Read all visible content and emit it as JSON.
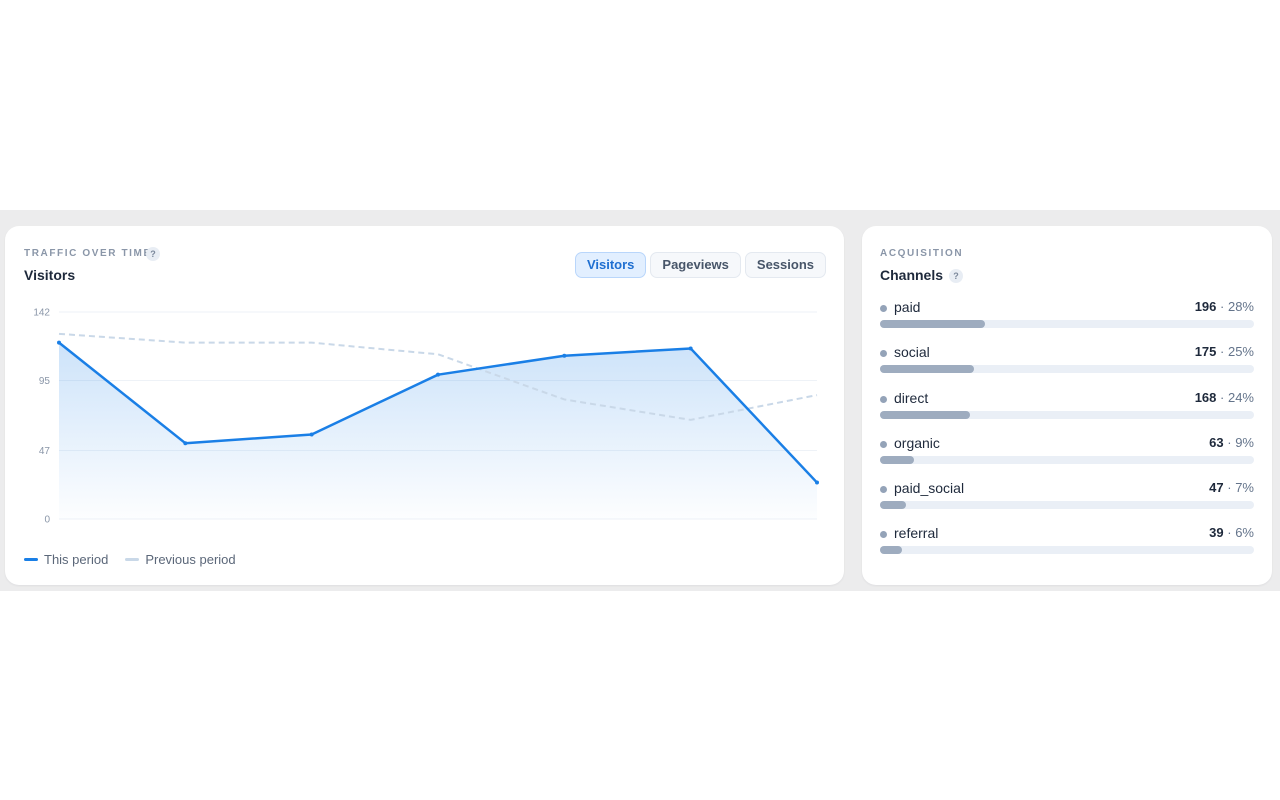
{
  "traffic": {
    "eyebrow": "TRAFFIC OVER TIME",
    "help": "?",
    "title": "Visitors",
    "tabs": [
      {
        "label": "Visitors",
        "active": true
      },
      {
        "label": "Pageviews",
        "active": false
      },
      {
        "label": "Sessions",
        "active": false
      }
    ],
    "legend": {
      "current": "This period",
      "previous": "Previous period"
    }
  },
  "chart_data": {
    "type": "area",
    "title": "Visitors",
    "ylim": [
      0,
      142
    ],
    "yticks": [
      0,
      47,
      95,
      142
    ],
    "grid": true,
    "legend_position": "bottom-left",
    "series": [
      {
        "name": "This period",
        "color": "#1a7fe6",
        "values": [
          121,
          52,
          58,
          99,
          112,
          117,
          25
        ]
      },
      {
        "name": "Previous period",
        "color": "#c9d8e8",
        "values": [
          127,
          121,
          121,
          113,
          82,
          68,
          85
        ]
      }
    ]
  },
  "acquisition": {
    "eyebrow": "ACQUISITION",
    "title": "Channels",
    "help": "?",
    "channels": [
      {
        "name": "paid",
        "count": "196",
        "pct": "28%"
      },
      {
        "name": "social",
        "count": "175",
        "pct": "25%"
      },
      {
        "name": "direct",
        "count": "168",
        "pct": "24%"
      },
      {
        "name": "organic",
        "count": "63",
        "pct": "9%"
      },
      {
        "name": "paid_social",
        "count": "47",
        "pct": "7%"
      },
      {
        "name": "referral",
        "count": "39",
        "pct": "6%"
      }
    ]
  }
}
